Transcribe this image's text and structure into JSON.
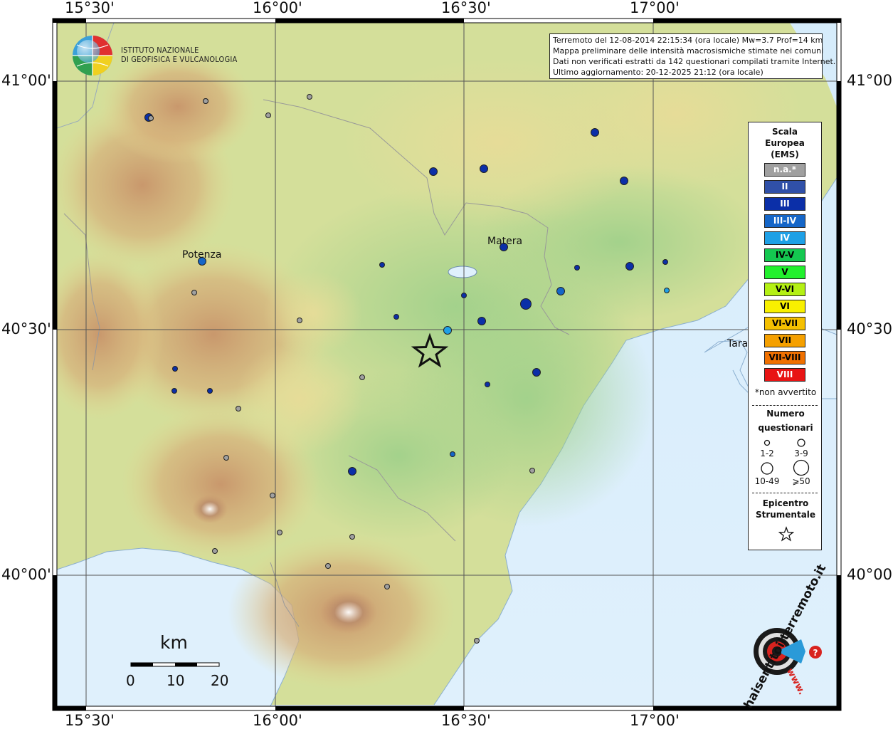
{
  "info_box": {
    "line1": "Terremoto del 12-08-2014 22:15:34 (ora locale) Mw=3.7 Prof=14 km",
    "line2": "Mappa preliminare delle intensità macrosismiche stimate nei comuni",
    "line3": "Dati non verificati estratti da 142 questionari compilati tramite Internet.",
    "line4": "Ultimo aggiornamento: 20-12-2025 21:12 (ora locale)"
  },
  "logo": {
    "line1": "ISTITUTO NAZIONALE",
    "line2": "DI GEOFISICA E VULCANOLOGIA"
  },
  "coords": {
    "top": [
      "15°30'",
      "16°00'",
      "16°30'",
      "17°00'"
    ],
    "bottom": [
      "15°30'",
      "16°00'",
      "16°30'",
      "17°00'"
    ],
    "left": [
      "41°00'",
      "40°30'",
      "40°00'"
    ],
    "right": [
      "41°00'",
      "40°30'",
      "40°00'"
    ]
  },
  "cities": {
    "potenza": "Potenza",
    "matera": "Matera",
    "taranto": "Tara"
  },
  "scale_bar": {
    "unit": "km",
    "ticks": [
      "0",
      "10",
      "20"
    ]
  },
  "legend": {
    "title_line1": "Scala",
    "title_line2": "Europea",
    "title_line3": "(EMS)",
    "classes": [
      {
        "label": "n.a.*",
        "color": "#a0a0a0",
        "text": "#ffffff"
      },
      {
        "label": "II",
        "color": "#3050a8",
        "text": "#ffffff"
      },
      {
        "label": "III",
        "color": "#0b2fa8",
        "text": "#ffffff"
      },
      {
        "label": "III-IV",
        "color": "#1566c8",
        "text": "#ffffff"
      },
      {
        "label": "IV",
        "color": "#1ea0e6",
        "text": "#ffffff"
      },
      {
        "label": "IV-V",
        "color": "#14c850",
        "text": "#000000"
      },
      {
        "label": "V",
        "color": "#22f02e",
        "text": "#000000"
      },
      {
        "label": "V-VI",
        "color": "#b4f014",
        "text": "#000000"
      },
      {
        "label": "VI",
        "color": "#f8f000",
        "text": "#000000"
      },
      {
        "label": "VI-VII",
        "color": "#f5c000",
        "text": "#000000"
      },
      {
        "label": "VII",
        "color": "#f5a000",
        "text": "#000000"
      },
      {
        "label": "VII-VIII",
        "color": "#f07000",
        "text": "#000000"
      },
      {
        "label": "VIII",
        "color": "#e81414",
        "text": "#ffffff"
      }
    ],
    "note": "*non avvertito",
    "questionnaires_title_1": "Numero",
    "questionnaires_title_2": "questionari",
    "sizes": [
      "1-2",
      "3-9",
      "10-49",
      "⩾50"
    ],
    "epicenter_title_1": "Epicentro",
    "epicenter_title_2": "Strumentale"
  },
  "hai_sentito": {
    "text": "haisentitoilterremoto.it",
    "prefix": "www."
  },
  "intensity_points": [
    {
      "cls": "III",
      "n": "3-9"
    },
    {
      "cls": "III",
      "n": "3-9"
    },
    {
      "cls": "III",
      "n": "3-9"
    },
    {
      "cls": "III",
      "n": "1-2"
    },
    {
      "cls": "III",
      "n": "1-2"
    },
    {
      "cls": "III",
      "n": "10-49"
    },
    {
      "cls": "III",
      "n": "3-9"
    },
    {
      "cls": "III",
      "n": "1-2"
    },
    {
      "cls": "III",
      "n": "3-9"
    },
    {
      "cls": "III",
      "n": "1-2"
    },
    {
      "cls": "III",
      "n": "1-2"
    },
    {
      "cls": "III",
      "n": "1-2"
    },
    {
      "cls": "III",
      "n": "3-9"
    },
    {
      "cls": "III",
      "n": "3-9"
    },
    {
      "cls": "III",
      "n": "3-9"
    },
    {
      "cls": "III-IV",
      "n": "3-9"
    },
    {
      "cls": "IV",
      "n": "3-9"
    },
    {
      "cls": "IV",
      "n": "1-2"
    },
    {
      "cls": "III-IV",
      "n": "3-9"
    },
    {
      "cls": "III",
      "n": "1-2"
    },
    {
      "cls": "III",
      "n": "1-2"
    },
    {
      "cls": "III",
      "n": "1-2"
    },
    {
      "cls": "III-IV",
      "n": "1-2"
    },
    {
      "cls": "III",
      "n": "3-9"
    },
    {
      "cls": "III",
      "n": "3-9"
    },
    {
      "cls": "III",
      "n": "1-2"
    },
    {
      "cls": "n.a.*",
      "n": "1-2"
    },
    {
      "cls": "n.a.*",
      "n": "1-2"
    },
    {
      "cls": "n.a.*",
      "n": "1-2"
    },
    {
      "cls": "n.a.*",
      "n": "1-2"
    },
    {
      "cls": "n.a.*",
      "n": "1-2"
    },
    {
      "cls": "n.a.*",
      "n": "1-2"
    },
    {
      "cls": "n.a.*",
      "n": "1-2"
    },
    {
      "cls": "n.a.*",
      "n": "1-2"
    },
    {
      "cls": "n.a.*",
      "n": "1-2"
    },
    {
      "cls": "n.a.*",
      "n": "1-2"
    },
    {
      "cls": "n.a.*",
      "n": "1-2"
    },
    {
      "cls": "n.a.*",
      "n": "1-2"
    },
    {
      "cls": "n.a.*",
      "n": "1-2"
    },
    {
      "cls": "n.a.*",
      "n": "1-2"
    },
    {
      "cls": "n.a.*",
      "n": "1-2"
    },
    {
      "cls": "n.a.*",
      "n": "1-2"
    },
    {
      "cls": "n.a.*",
      "n": "1-2"
    },
    {
      "cls": "n.a.*",
      "n": "1-2"
    }
  ]
}
